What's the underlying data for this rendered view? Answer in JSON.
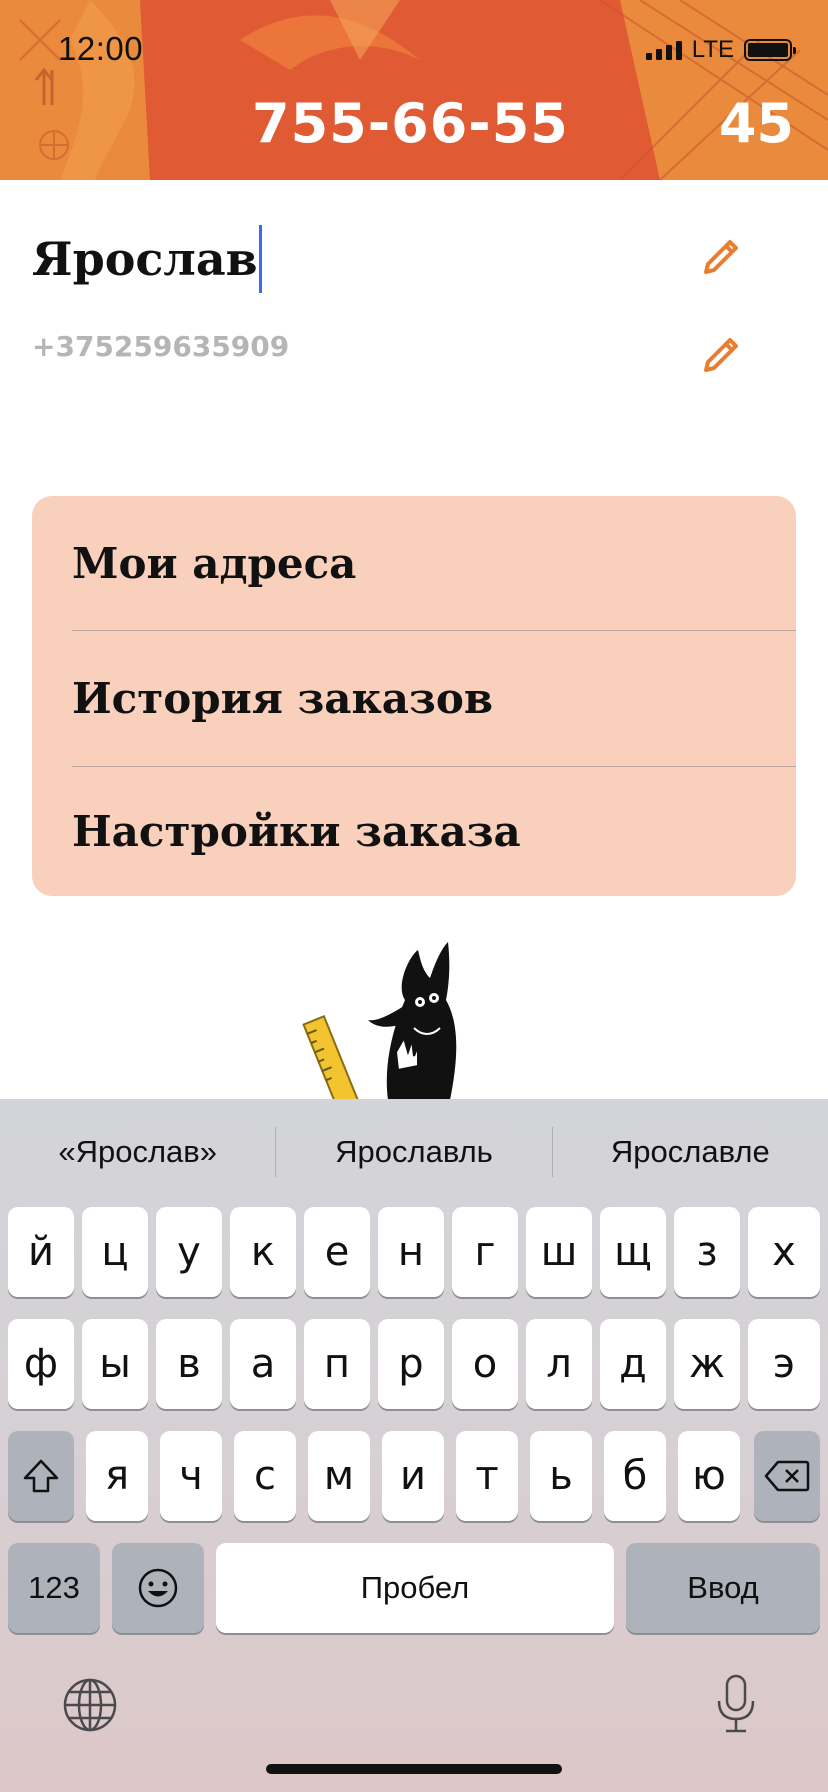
{
  "status_bar": {
    "time": "12:00",
    "network": "LTE"
  },
  "header": {
    "phone": "755-66-55",
    "counter": "45",
    "accent_color": "#ea8a3c",
    "accent_dark": "#e05a33"
  },
  "profile": {
    "name": "Ярослав",
    "phone": "+375259635909"
  },
  "menu": {
    "items": [
      {
        "label": "Мои адреса"
      },
      {
        "label": "История заказов"
      },
      {
        "label": "Настройки заказа"
      }
    ],
    "background": "#f8d0bc"
  },
  "keyboard": {
    "suggestions": [
      "«Ярослав»",
      "Ярославль",
      "Ярославле"
    ],
    "rows": [
      [
        "й",
        "ц",
        "у",
        "к",
        "е",
        "н",
        "г",
        "ш",
        "щ",
        "з",
        "х"
      ],
      [
        "ф",
        "ы",
        "в",
        "а",
        "п",
        "р",
        "о",
        "л",
        "д",
        "ж",
        "э"
      ],
      [
        "я",
        "ч",
        "с",
        "м",
        "и",
        "т",
        "ь",
        "б",
        "ю"
      ]
    ],
    "numbers_label": "123",
    "space_label": "Пробел",
    "return_label": "Ввод",
    "icons": [
      "shift-icon",
      "backspace-icon",
      "emoji-icon",
      "globe-icon",
      "microphone-icon",
      "pencil-icon"
    ]
  }
}
